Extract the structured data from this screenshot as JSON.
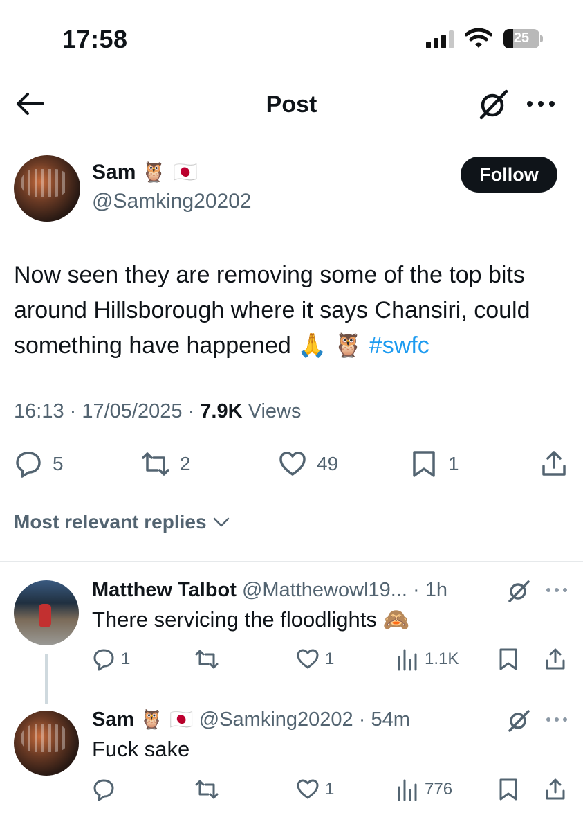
{
  "status_bar": {
    "time": "17:58",
    "battery": "25",
    "icons": [
      "signal-icon",
      "wifi-icon",
      "battery-icon"
    ]
  },
  "nav": {
    "title": "Post",
    "back_icon": "arrow-left-icon",
    "grok_icon": "grok-icon",
    "more_icon": "more-dots-icon"
  },
  "author": {
    "name": "Sam",
    "name_emojis": "🦉 🇯🇵",
    "handle": "@Samking20202",
    "follow_label": "Follow"
  },
  "post": {
    "text": "Now seen they are removing some of the top bits around Hillsborough where it says Chansiri, could something have happened 🙏 🦉 ",
    "hashtag": "#swfc",
    "time": "16:13",
    "date": "17/05/2025",
    "views_count": "7.9K",
    "views_label": "Views"
  },
  "actions": {
    "replies": "5",
    "reposts": "2",
    "likes": "49",
    "bookmarks": "1"
  },
  "replies_header": {
    "label": "Most relevant replies",
    "icon": "chevron-down-icon"
  },
  "replies": [
    {
      "name": "Matthew Talbot",
      "name_emojis": "",
      "handle": "@Matthewowl19...",
      "time": "1h",
      "text": "There servicing the floodlights 🙈",
      "replies": "1",
      "reposts": "",
      "likes": "1",
      "views": "1.1K"
    },
    {
      "name": "Sam",
      "name_emojis": "🦉 🇯🇵",
      "handle": "@Samking20202",
      "time": "54m",
      "text": "Fuck sake",
      "replies": "",
      "reposts": "",
      "likes": "1",
      "views": "776"
    }
  ],
  "colors": {
    "text": "#0f1419",
    "secondary": "#536471",
    "link": "#1d9bf0",
    "follow_bg": "#0f1419"
  }
}
